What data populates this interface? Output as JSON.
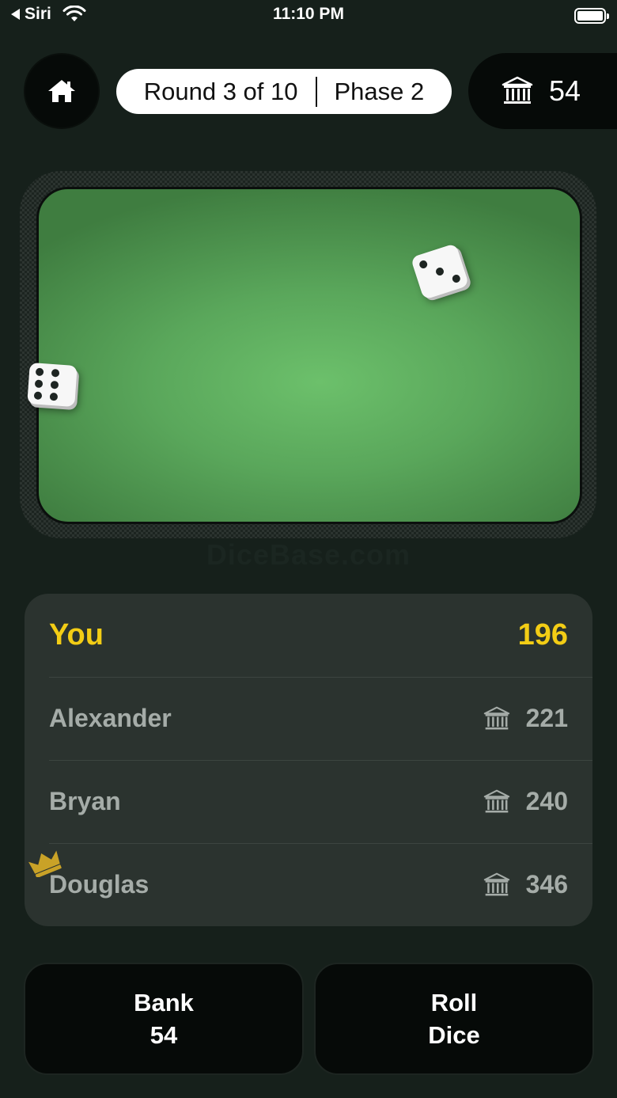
{
  "status_bar": {
    "back_label": "Siri",
    "time": "11:10 PM"
  },
  "header": {
    "round_label": "Round 3 of 10",
    "phase_label": "Phase 2",
    "bank_total": "54",
    "home_icon": "home-icon",
    "bank_icon": "bank-icon"
  },
  "table": {
    "watermark": "DiceBase.com",
    "dice": [
      {
        "face": 3
      },
      {
        "face": 6
      }
    ]
  },
  "players": [
    {
      "name": "You",
      "score": "196",
      "current": true
    },
    {
      "name": "Alexander",
      "score": "221",
      "banked": true
    },
    {
      "name": "Bryan",
      "score": "240",
      "banked": true
    },
    {
      "name": "Douglas",
      "score": "346",
      "banked": true,
      "leader": true
    }
  ],
  "actions": {
    "bank_label": "Bank",
    "bank_value": "54",
    "roll_line1": "Roll",
    "roll_line2": "Dice"
  },
  "colors": {
    "background": "#16201b",
    "felt": "#5aa75b",
    "highlight": "#f3cd15",
    "leader": "#c9a227"
  }
}
